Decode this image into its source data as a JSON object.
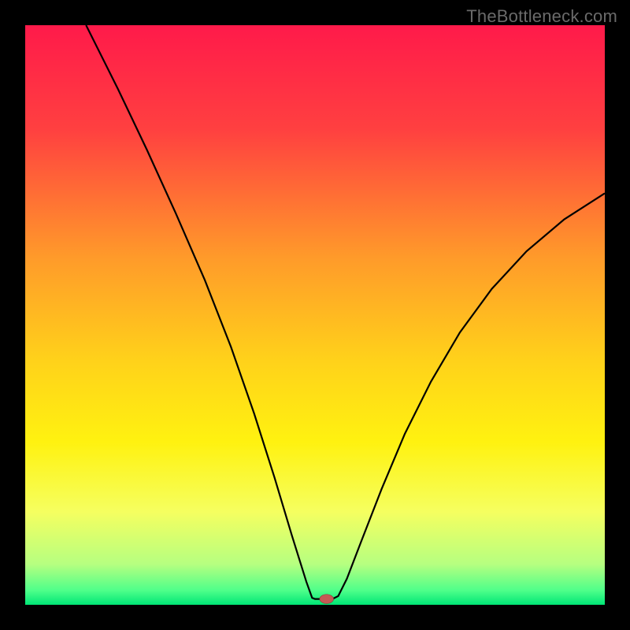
{
  "watermark": {
    "text": "TheBottleneck.com"
  },
  "chart_data": {
    "type": "line",
    "title": "",
    "xlabel": "",
    "ylabel": "",
    "xlim": [
      0,
      100
    ],
    "ylim": [
      0,
      100
    ],
    "grid": false,
    "legend": false,
    "background_gradient": {
      "stops": [
        {
          "offset": 0.0,
          "color": "#ff1a4a"
        },
        {
          "offset": 0.18,
          "color": "#ff4040"
        },
        {
          "offset": 0.4,
          "color": "#ff9a2a"
        },
        {
          "offset": 0.58,
          "color": "#ffd21a"
        },
        {
          "offset": 0.72,
          "color": "#fff210"
        },
        {
          "offset": 0.84,
          "color": "#f5ff60"
        },
        {
          "offset": 0.93,
          "color": "#b6ff80"
        },
        {
          "offset": 0.975,
          "color": "#4fff8a"
        },
        {
          "offset": 1.0,
          "color": "#00e676"
        }
      ]
    },
    "series": [
      {
        "name": "bottleneck-curve",
        "data": [
          {
            "x": 10.5,
            "y": 100.0
          },
          {
            "x": 16.0,
            "y": 89.0
          },
          {
            "x": 21.0,
            "y": 78.5
          },
          {
            "x": 26.0,
            "y": 67.5
          },
          {
            "x": 31.0,
            "y": 56.0
          },
          {
            "x": 35.5,
            "y": 44.5
          },
          {
            "x": 39.5,
            "y": 33.0
          },
          {
            "x": 43.0,
            "y": 22.0
          },
          {
            "x": 46.0,
            "y": 12.0
          },
          {
            "x": 48.5,
            "y": 4.0
          },
          {
            "x": 49.5,
            "y": 1.2
          },
          {
            "x": 50.0,
            "y": 1.0
          },
          {
            "x": 51.5,
            "y": 1.0
          },
          {
            "x": 53.0,
            "y": 1.0
          },
          {
            "x": 54.0,
            "y": 1.5
          },
          {
            "x": 55.5,
            "y": 4.5
          },
          {
            "x": 58.0,
            "y": 11.0
          },
          {
            "x": 61.5,
            "y": 20.0
          },
          {
            "x": 65.5,
            "y": 29.5
          },
          {
            "x": 70.0,
            "y": 38.5
          },
          {
            "x": 75.0,
            "y": 47.0
          },
          {
            "x": 80.5,
            "y": 54.5
          },
          {
            "x": 86.5,
            "y": 61.0
          },
          {
            "x": 93.0,
            "y": 66.5
          },
          {
            "x": 100.0,
            "y": 71.0
          }
        ]
      }
    ],
    "marker": {
      "x": 52.0,
      "y": 1.0,
      "rx": 1.2,
      "ry": 0.8,
      "color": "#c45a55"
    }
  }
}
